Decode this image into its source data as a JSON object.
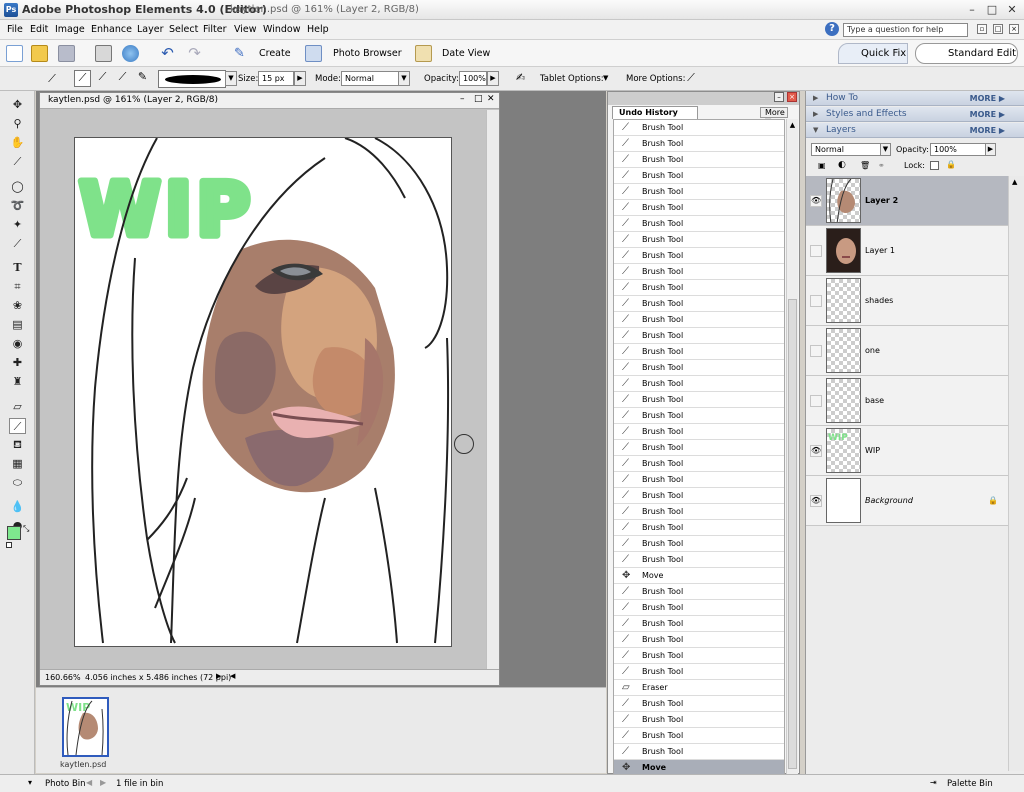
{
  "app": {
    "title": "Adobe Photoshop Elements 4.0 (Editor)",
    "document_caption": "kaytlen.psd @ 161% (Layer 2, RGB/8)"
  },
  "menu": [
    "File",
    "Edit",
    "Image",
    "Enhance",
    "Layer",
    "Select",
    "Filter",
    "View",
    "Window",
    "Help"
  ],
  "help_search_placeholder": "Type a question for help",
  "shortcuts": {
    "create": "Create",
    "photo_browser": "Photo Browser",
    "date_view": "Date View",
    "quick_fix": "Quick Fix",
    "standard_edit": "Standard Edit"
  },
  "options_bar": {
    "size_label": "Size:",
    "size_value": "15 px",
    "mode_label": "Mode:",
    "mode_value": "Normal",
    "opacity_label": "Opacity:",
    "opacity_value": "100%",
    "tablet_options": "Tablet Options:",
    "more_options": "More Options:"
  },
  "document": {
    "title": "kaytlen.psd @ 161% (Layer 2, RGB/8)",
    "zoom": "160.66%",
    "info": "4.056 inches x 5.486 inches (72 ppi)",
    "canvas_text": "WIP"
  },
  "photo_bin": {
    "label": "Photo Bin",
    "count": "1 file in bin",
    "items": [
      "kaytlen.psd"
    ]
  },
  "undo_history": {
    "tab": "Undo History",
    "more": "More",
    "items": [
      "Brush Tool",
      "Brush Tool",
      "Brush Tool",
      "Brush Tool",
      "Brush Tool",
      "Brush Tool",
      "Brush Tool",
      "Brush Tool",
      "Brush Tool",
      "Brush Tool",
      "Brush Tool",
      "Brush Tool",
      "Brush Tool",
      "Brush Tool",
      "Brush Tool",
      "Brush Tool",
      "Brush Tool",
      "Brush Tool",
      "Brush Tool",
      "Brush Tool",
      "Brush Tool",
      "Brush Tool",
      "Brush Tool",
      "Brush Tool",
      "Brush Tool",
      "Brush Tool",
      "Brush Tool",
      "Brush Tool",
      "Move",
      "Brush Tool",
      "Brush Tool",
      "Brush Tool",
      "Brush Tool",
      "Brush Tool",
      "Brush Tool",
      "Eraser",
      "Brush Tool",
      "Brush Tool",
      "Brush Tool",
      "Brush Tool",
      "Move"
    ],
    "selected_index": 40
  },
  "palette_bin": {
    "label": "Palette Bin",
    "sections": [
      "How To",
      "Styles and Effects",
      "Layers"
    ],
    "more": "MORE",
    "blend_mode": "Normal",
    "opacity_label": "Opacity:",
    "opacity_value": "100%",
    "lock_label": "Lock:"
  },
  "layers": [
    {
      "name": "Layer 2",
      "visible": true,
      "selected": true
    },
    {
      "name": "Layer 1",
      "visible": false,
      "selected": false
    },
    {
      "name": "shades",
      "visible": false,
      "selected": false
    },
    {
      "name": "one",
      "visible": false,
      "selected": false
    },
    {
      "name": "base",
      "visible": false,
      "selected": false
    },
    {
      "name": "WIP",
      "visible": true,
      "selected": false
    },
    {
      "name": "Background",
      "visible": true,
      "selected": false,
      "locked": true
    }
  ],
  "colors": {
    "foreground": "#7ee88e",
    "background": "#000000",
    "wip_green": "#7fe28a",
    "selection": "#b5b8c0"
  }
}
